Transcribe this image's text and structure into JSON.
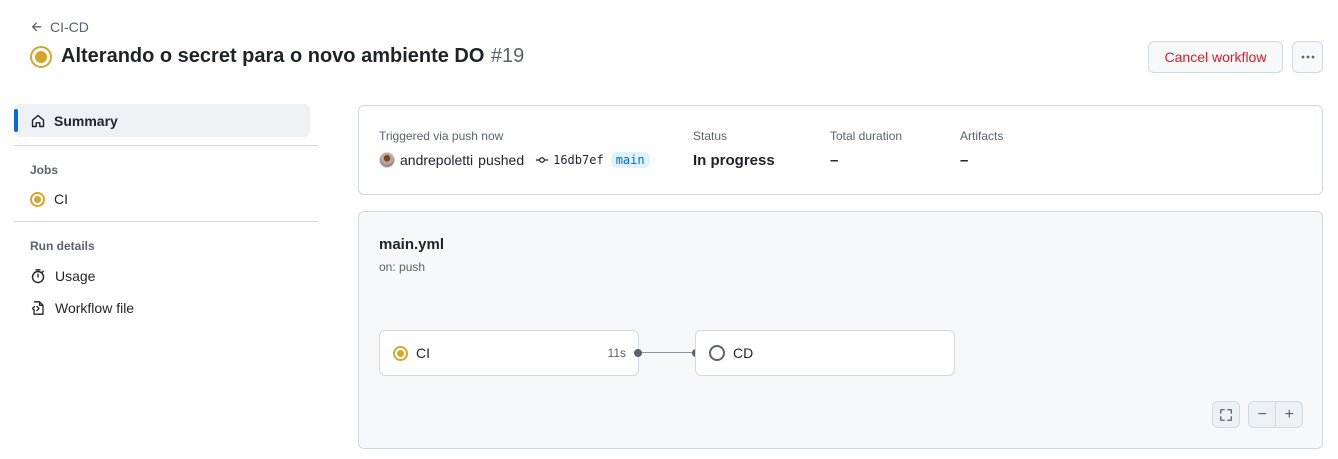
{
  "breadcrumb": {
    "back_label": "CI-CD"
  },
  "header": {
    "title": "Alterando o secret para o novo ambiente DO",
    "run_number": "#19",
    "status": "in-progress",
    "cancel_label": "Cancel workflow",
    "more_label": "···"
  },
  "sidebar": {
    "summary_label": "Summary",
    "jobs_title": "Jobs",
    "jobs": [
      {
        "label": "CI",
        "status": "in-progress"
      }
    ],
    "details_title": "Run details",
    "usage_label": "Usage",
    "workflow_file_label": "Workflow file"
  },
  "run_info": {
    "trigger_label": "Triggered via push now",
    "actor": "andrepoletti",
    "action": "pushed",
    "commit": "16db7ef",
    "branch": "main",
    "status_label": "Status",
    "status_value": "In progress",
    "duration_label": "Total duration",
    "duration_value": "–",
    "artifacts_label": "Artifacts",
    "artifacts_value": "–"
  },
  "graph": {
    "workflow_file": "main.yml",
    "trigger": "on: push",
    "jobs": [
      {
        "name": "CI",
        "status": "in-progress",
        "time": "11s"
      },
      {
        "name": "CD",
        "status": "pending",
        "time": ""
      }
    ],
    "zoom_out_label": "−",
    "zoom_in_label": "+"
  },
  "colors": {
    "in_progress": "#d4a72c",
    "accent": "#0969da",
    "danger": "#cf222e",
    "muted": "#59636e"
  }
}
